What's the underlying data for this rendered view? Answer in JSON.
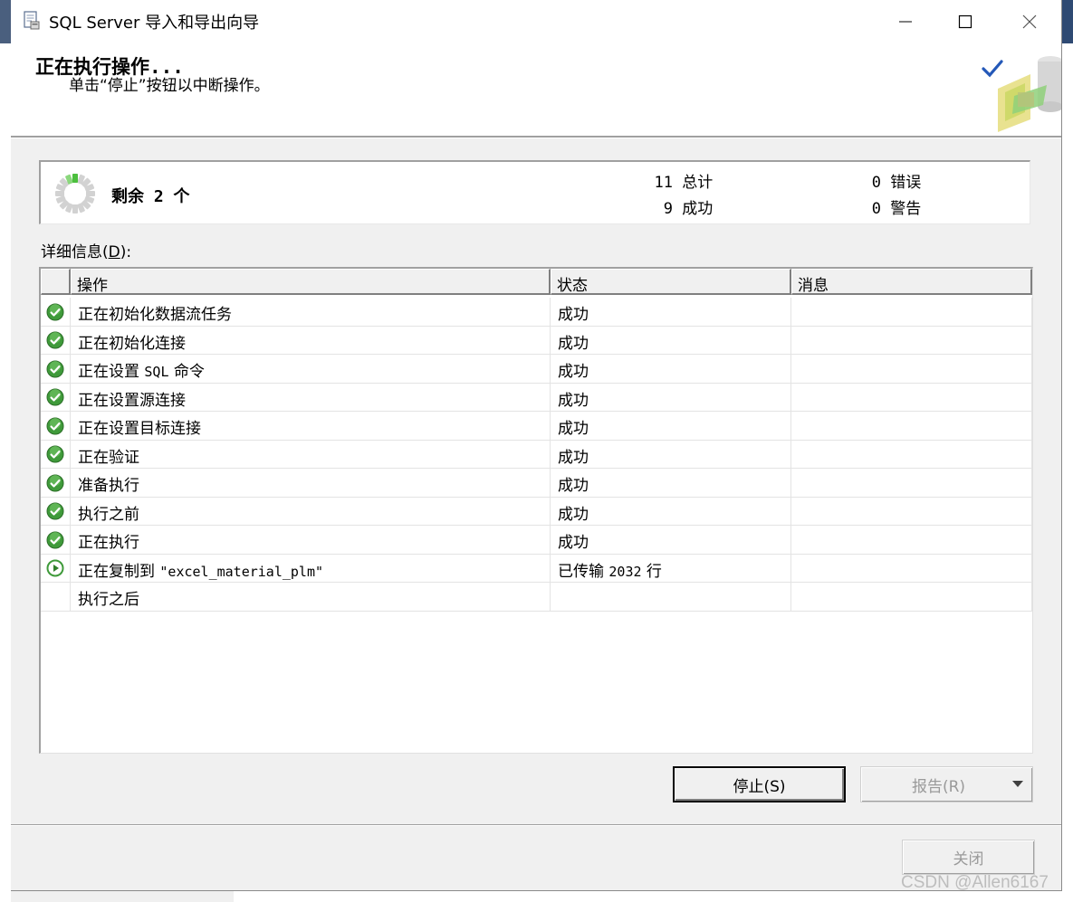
{
  "window": {
    "title": "SQL Server 导入和导出向导",
    "controls": {
      "minimize": "minimize-icon",
      "maximize": "maximize-icon",
      "close": "close-icon"
    }
  },
  "header": {
    "title": "正在执行操作...",
    "subtitle": "单击“停止”按钮以中断操作。"
  },
  "summary": {
    "remaining": "剩余 2 个",
    "total_num": "11",
    "total_label": "总计",
    "success_num": "9",
    "success_label": "成功",
    "error_num": "0",
    "error_label": "错误",
    "warning_num": "0",
    "warning_label": "警告"
  },
  "details": {
    "label_prefix": "详细信息(",
    "label_key": "D",
    "label_suffix": "):",
    "columns": [
      "操作",
      "状态",
      "消息"
    ],
    "rows": [
      {
        "icon": "success",
        "op": "正在初始化数据流任务",
        "status": "成功",
        "msg": ""
      },
      {
        "icon": "success",
        "op": "正在初始化连接",
        "status": "成功",
        "msg": ""
      },
      {
        "icon": "success",
        "op_a": "正在设置 ",
        "op_b": "SQL",
        "op_c": " 命令",
        "op": "正在设置 SQL 命令",
        "status": "成功",
        "msg": ""
      },
      {
        "icon": "success",
        "op": "正在设置源连接",
        "status": "成功",
        "msg": ""
      },
      {
        "icon": "success",
        "op": "正在设置目标连接",
        "status": "成功",
        "msg": ""
      },
      {
        "icon": "success",
        "op": "正在验证",
        "status": "成功",
        "msg": ""
      },
      {
        "icon": "success",
        "op": "准备执行",
        "status": "成功",
        "msg": ""
      },
      {
        "icon": "success",
        "op": "执行之前",
        "status": "成功",
        "msg": ""
      },
      {
        "icon": "success",
        "op": "正在执行",
        "status": "成功",
        "msg": ""
      },
      {
        "icon": "running",
        "op_a": "正在复制到 ",
        "op_b": "\"excel_material_plm\"",
        "op": "正在复制到 \"excel_material_plm\"",
        "status_a": "已传输 ",
        "status_b": "2032",
        "status_c": " 行",
        "status": "已传输 2032 行",
        "msg": ""
      },
      {
        "icon": "none",
        "op": "执行之后",
        "status": "",
        "msg": ""
      }
    ]
  },
  "buttons": {
    "stop": "停止(S)",
    "report": "报告(R)",
    "close": "关闭"
  },
  "watermark": "CSDN @Allen6167",
  "colors": {
    "success": "#3f9a3a",
    "running_ring": "#3f9a3a",
    "accent": "#1f5fbf"
  }
}
